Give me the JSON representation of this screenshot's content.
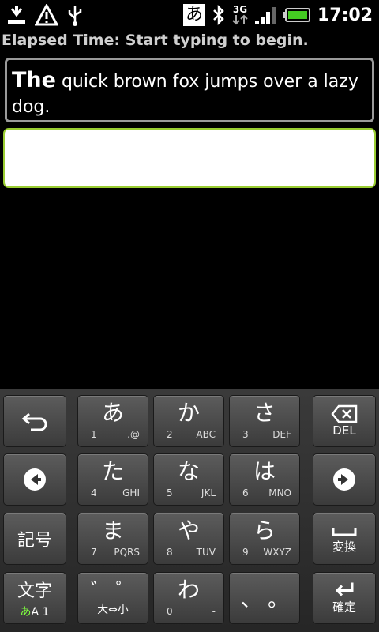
{
  "status_bar": {
    "ime_indicator": "あ",
    "network": "3G",
    "time": "17:02",
    "icons": [
      "download-icon",
      "warning-icon",
      "usb-icon",
      "bluetooth-icon",
      "signal-icon",
      "battery-icon"
    ]
  },
  "elapsed_text": "Elapsed Time: Start typing to begin.",
  "prompt": {
    "highlight": "The",
    "rest": " quick brown fox jumps over a lazy dog."
  },
  "input": {
    "value": "",
    "placeholder": ""
  },
  "keyboard": {
    "del_label": "DEL",
    "kigou_label": "記号",
    "henkan_label": "変換",
    "moji_label": "文字",
    "moji_mode": "あ",
    "moji_rest": "A 1",
    "kakutei_label": "確定",
    "dakuten_main": "゛ ゜",
    "dakuten_sub": "大⇔小",
    "punct_main": "、 。",
    "keys": [
      {
        "main": "あ",
        "num": "1",
        "letters": ".@"
      },
      {
        "main": "か",
        "num": "2",
        "letters": "ABC"
      },
      {
        "main": "さ",
        "num": "3",
        "letters": "DEF"
      },
      {
        "main": "た",
        "num": "4",
        "letters": "GHI"
      },
      {
        "main": "な",
        "num": "5",
        "letters": "JKL"
      },
      {
        "main": "は",
        "num": "6",
        "letters": "MNO"
      },
      {
        "main": "ま",
        "num": "7",
        "letters": "PQRS"
      },
      {
        "main": "や",
        "num": "8",
        "letters": "TUV"
      },
      {
        "main": "ら",
        "num": "9",
        "letters": "WXYZ"
      },
      {
        "main": "わ",
        "num": "0",
        "letters": "-"
      }
    ]
  },
  "colors": {
    "input_border": "#9acd32",
    "battery": "#44cc22"
  }
}
